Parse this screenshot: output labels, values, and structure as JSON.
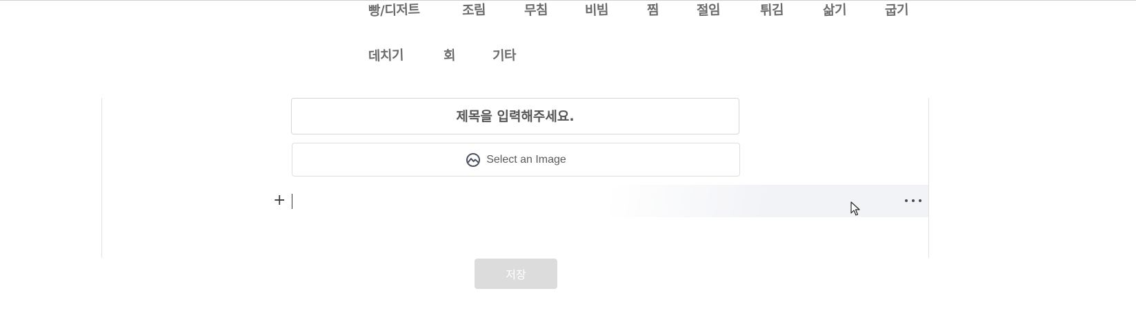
{
  "categories": {
    "row1": [
      "빵/디저트",
      "조림",
      "무침",
      "비빔",
      "찜",
      "절임",
      "튀김",
      "삶기",
      "굽기"
    ],
    "row2": [
      "데치기",
      "회",
      "기타"
    ]
  },
  "editor": {
    "title_placeholder": "제목을 입력해주세요.",
    "image_select_label": "Select an Image",
    "plus_label": "+"
  },
  "actions": {
    "save_label": "저장"
  },
  "icons": {
    "image": "image-icon",
    "plus": "plus-icon",
    "more": "more-horizontal-icon",
    "cursor": "mouse-pointer-icon"
  },
  "colors": {
    "category_text": "#6b6b6b",
    "save_button_bg": "#dcdcdc",
    "block_highlight": "#f2f3f7"
  }
}
